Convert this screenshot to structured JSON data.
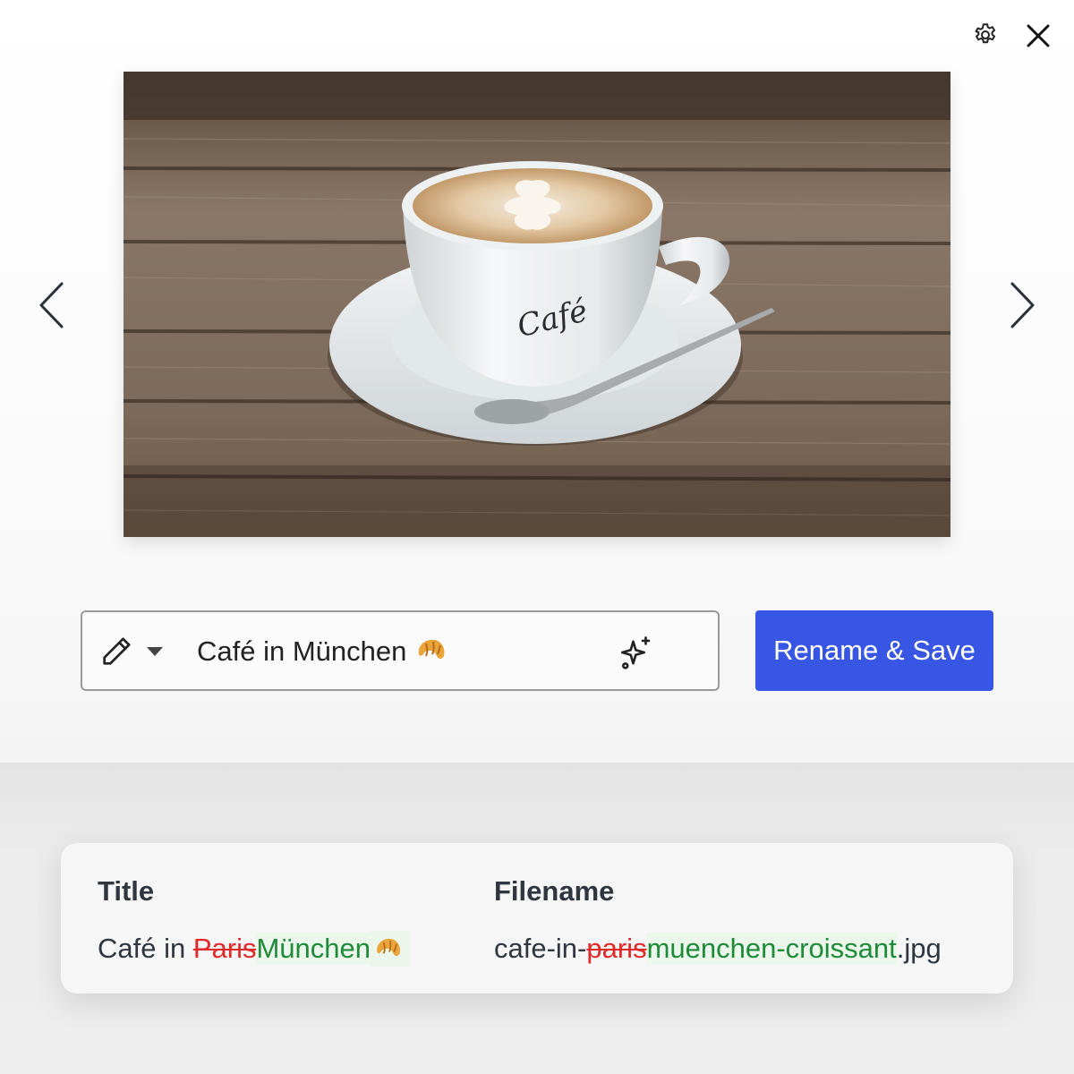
{
  "toolbar": {
    "settings_icon": "gear-icon",
    "close_icon": "close-icon"
  },
  "navigation": {
    "prev_icon": "chevron-left-icon",
    "next_icon": "chevron-right-icon"
  },
  "photo": {
    "subject": "Café"
  },
  "title_field": {
    "mode_icon": "pencil-icon",
    "dropdown_icon": "caret-down-icon",
    "value": "Café in München",
    "emoji": "croissant",
    "ai_icon": "sparkle-icon"
  },
  "actions": {
    "rename_save_label": "Rename & Save",
    "accent_color": "#3856e4"
  },
  "diff": {
    "title": {
      "header": "Title",
      "unchanged_prefix": "Café in ",
      "removed": "Paris",
      "added": "München",
      "added_emoji": "croissant"
    },
    "filename": {
      "header": "Filename",
      "unchanged_prefix": "cafe-in-",
      "removed": "paris",
      "added": "muenchen-croissant",
      "unchanged_suffix": ".jpg"
    },
    "removed_color": "#e02a2a",
    "added_color": "#1f8a3a"
  }
}
